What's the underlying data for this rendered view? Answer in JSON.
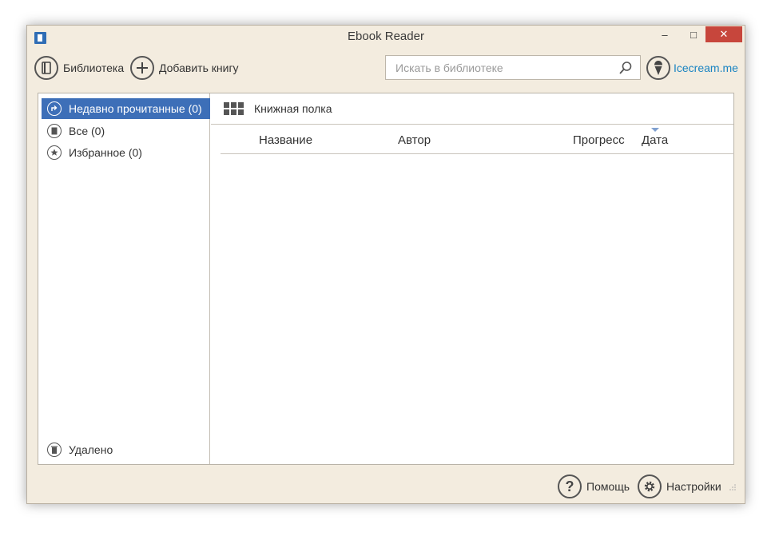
{
  "window": {
    "title": "Ebook Reader",
    "minimize": "–",
    "maximize": "□",
    "close": "✕"
  },
  "toolbar": {
    "library_label": "Библиотека",
    "add_book_label": "Добавить книгу",
    "search_placeholder": "Искать в библиотеке",
    "brand_link": "Icecream.me"
  },
  "sidebar": {
    "items": [
      {
        "label": "Недавно прочитанные (0)",
        "icon": "recent-icon",
        "active": true
      },
      {
        "label": "Все (0)",
        "icon": "book-icon"
      },
      {
        "label": "Избранное (0)",
        "icon": "star-icon"
      }
    ],
    "deleted_label": "Удалено"
  },
  "content": {
    "shelf_label": "Книжная полка",
    "columns": [
      "Название",
      "Автор",
      "Прогресс",
      "Дата"
    ],
    "sorted_column": "Дата"
  },
  "footer": {
    "help_label": "Помощь",
    "settings_label": "Настройки"
  },
  "colors": {
    "accent": "#3d6fb8",
    "link": "#1a84c2",
    "close": "#c7463c",
    "window_bg": "#f3ecdf"
  }
}
